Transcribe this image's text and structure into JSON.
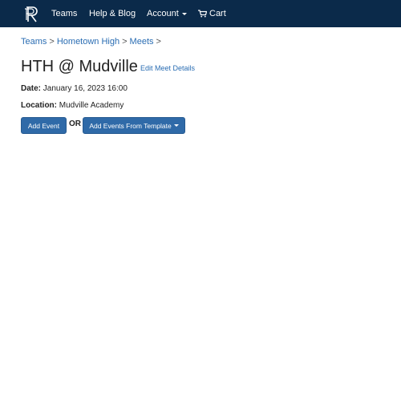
{
  "navbar": {
    "logo_icon": "r-logo-icon",
    "teams": "Teams",
    "help_blog": "Help & Blog",
    "account": "Account",
    "cart": "Cart",
    "cart_icon": "cart-icon",
    "background": "#0b2a4a"
  },
  "breadcrumb": {
    "items": [
      "Teams",
      "Hometown High",
      "Meets"
    ],
    "separator": ">"
  },
  "meet": {
    "title": "HTH @ Mudville",
    "edit_link": "Edit Meet Details",
    "date_label": "Date:",
    "date_value": "January 16, 2023 16:00",
    "location_label": "Location:",
    "location_value": "Mudville Academy"
  },
  "actions": {
    "add_event": "Add Event",
    "or": "OR",
    "add_from_template": "Add Events From Template",
    "button_color": "#2f6aa8"
  }
}
